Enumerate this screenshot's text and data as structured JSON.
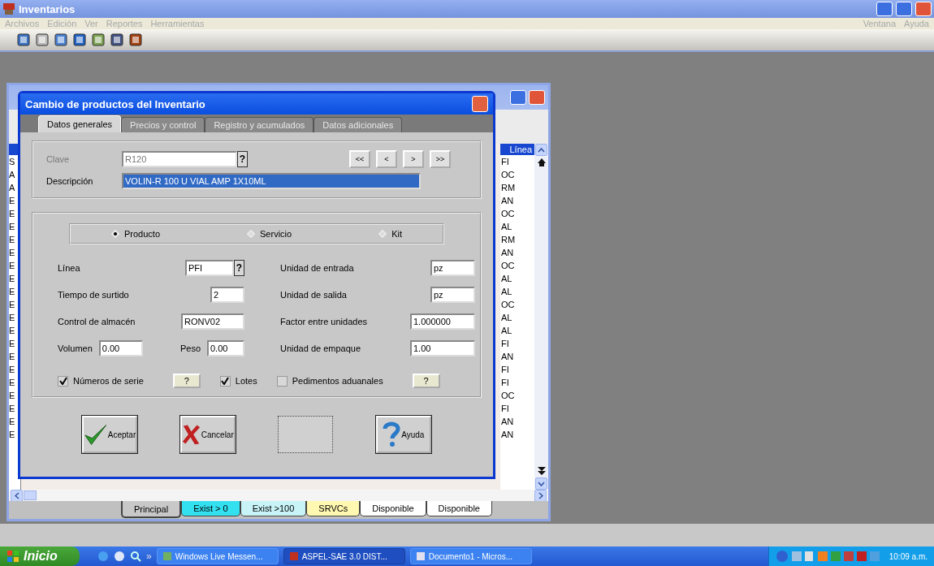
{
  "window": {
    "title": "Inventarios",
    "menu": [
      "Archivos",
      "Edición",
      "Ver",
      "Reportes",
      "Herramientas"
    ],
    "menu_right": [
      "Ventana",
      "Ayuda"
    ]
  },
  "list_window": {
    "column_1": [
      "S",
      "A",
      "A",
      "E",
      "E",
      "E",
      "E",
      "E",
      "E",
      "E",
      "E",
      "E",
      "E",
      "E",
      "E",
      "E",
      "E",
      "E",
      "E",
      "E",
      "E",
      "E"
    ],
    "linea": {
      "header": "Línea",
      "values": [
        "FI",
        "OC",
        "RM",
        "AN",
        "OC",
        "AL",
        "RM",
        "AN",
        "OC",
        "AL",
        "AL",
        "OC",
        "AL",
        "AL",
        "FI",
        "AN",
        "FI",
        "FI",
        "OC",
        "FI",
        "AN",
        "AN"
      ]
    },
    "tabs": [
      {
        "label": "Principal",
        "selected": true,
        "color": "#c8c8c8"
      },
      {
        "label": "Exist > 0",
        "selected": false,
        "color": "#33e0f0"
      },
      {
        "label": "Exist >100",
        "selected": false,
        "color": "#c8f4f8"
      },
      {
        "label": "SRVCs",
        "selected": false,
        "color": "#fff8b0"
      },
      {
        "label": "Disponible",
        "selected": false,
        "color": "#ffffff"
      },
      {
        "label": "Disponible",
        "selected": false,
        "color": "#ffffff"
      }
    ]
  },
  "dialog": {
    "title": "Cambio de productos del Inventario",
    "tabs": [
      {
        "label": "Datos generales",
        "selected": true
      },
      {
        "label": "Precios y control",
        "selected": false
      },
      {
        "label": "Registro y acumulados",
        "selected": false
      },
      {
        "label": "Datos adicionales",
        "selected": false
      }
    ],
    "clave": {
      "label": "Clave",
      "value": "R120",
      "disabled": true,
      "lookup": "?"
    },
    "nav_buttons": [
      "<<",
      "<",
      ">",
      ">>"
    ],
    "descripcion": {
      "label": "Descripción",
      "value": "VOLIN-R 100 U VIAL AMP 1X10ML",
      "selected": true
    },
    "type_options": [
      {
        "label": "Producto",
        "selected": true
      },
      {
        "label": "Servicio",
        "selected": false
      },
      {
        "label": "Kit",
        "selected": false
      }
    ],
    "fields_left": [
      {
        "label": "Línea",
        "value": "PFI",
        "lookup": "?"
      },
      {
        "label": "Tiempo de surtido",
        "value": "2"
      },
      {
        "label": "Control de almacén",
        "value": "RONV02"
      }
    ],
    "volumen": {
      "label": "Volumen",
      "value": "0.00"
    },
    "peso": {
      "label": "Peso",
      "value": "0.00"
    },
    "fields_right": [
      {
        "label": "Unidad de entrada",
        "value": "pz"
      },
      {
        "label": "Unidad de salida",
        "value": "pz"
      },
      {
        "label": "Factor entre unidades",
        "value": "1.000000"
      },
      {
        "label": "Unidad de empaque",
        "value": "1.00"
      }
    ],
    "options": [
      {
        "label": "Números de serie",
        "checked": true,
        "help": "?"
      },
      {
        "label": "Lotes",
        "checked": true
      },
      {
        "label": "Pedimentos aduanales",
        "checked": false,
        "help": "?"
      }
    ],
    "buttons": [
      {
        "label": "Aceptar",
        "kind": "accept",
        "disabled": false
      },
      {
        "label": "Cancelar",
        "kind": "cancel",
        "disabled": false
      },
      {
        "kind": "blank",
        "disabled": true
      },
      {
        "label": "Ayuda",
        "kind": "help",
        "disabled": false
      }
    ]
  },
  "taskbar": {
    "start": "Inicio",
    "chevron": "»",
    "tasks": [
      {
        "label": "Windows Live Messen...",
        "selected": false
      },
      {
        "label": "ASPEL-SAE 3.0  DIST...",
        "selected": true
      },
      {
        "label": "Documento1 - Micros...",
        "selected": false
      }
    ],
    "clock": "10:09 a.m."
  }
}
